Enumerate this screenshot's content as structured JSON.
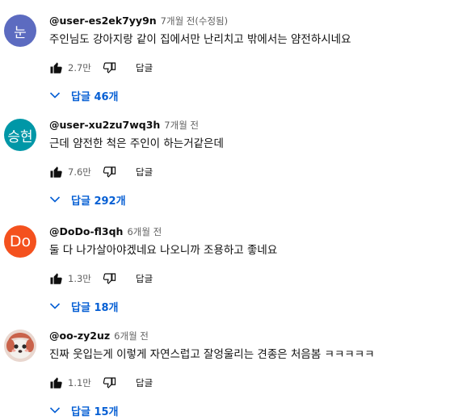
{
  "colors": {
    "link_blue": "#065fd4",
    "meta_gray": "#606060",
    "text_dark": "#0f0f0f"
  },
  "actions": {
    "reply_label": "답글"
  },
  "comments": [
    {
      "avatar_text": "눈",
      "avatar_color": "#5c6bc0",
      "author": "@user-es2ek7yy9n",
      "time": "7개월 전(수정됨)",
      "text": "주인님도 강아지랑 같이 집에서만 난리치고 밖에서는 얌전하시네요",
      "likes": "2.7만",
      "replies_label": "답글 46개"
    },
    {
      "avatar_text": "승현",
      "avatar_color": "#0097a7",
      "author": "@user-xu2zu7wq3h",
      "time": "7개월 전",
      "text": "근데 얌전한 척은 주인이 하는거같은데",
      "likes": "7.6만",
      "replies_label": "답글 292개"
    },
    {
      "avatar_text": "Do",
      "avatar_color": "#f4511e",
      "author": "@DoDo-fl3qh",
      "time": "6개월 전",
      "text": "둘 다 나가살아야겠네요 나오니까 조용하고 좋네요",
      "likes": "1.3만",
      "replies_label": "답글 18개"
    },
    {
      "avatar_text": "",
      "avatar_color": "#e9d7cf",
      "author": "@oo-zy2uz",
      "time": "6개월 전",
      "text": "진짜 웃입는게 이렇게 자연스럽고 잘엉울리는 견종은 처음봄 ㅋㅋㅋㅋㅋ",
      "likes": "1.1만",
      "replies_label": "답글 15개"
    }
  ]
}
